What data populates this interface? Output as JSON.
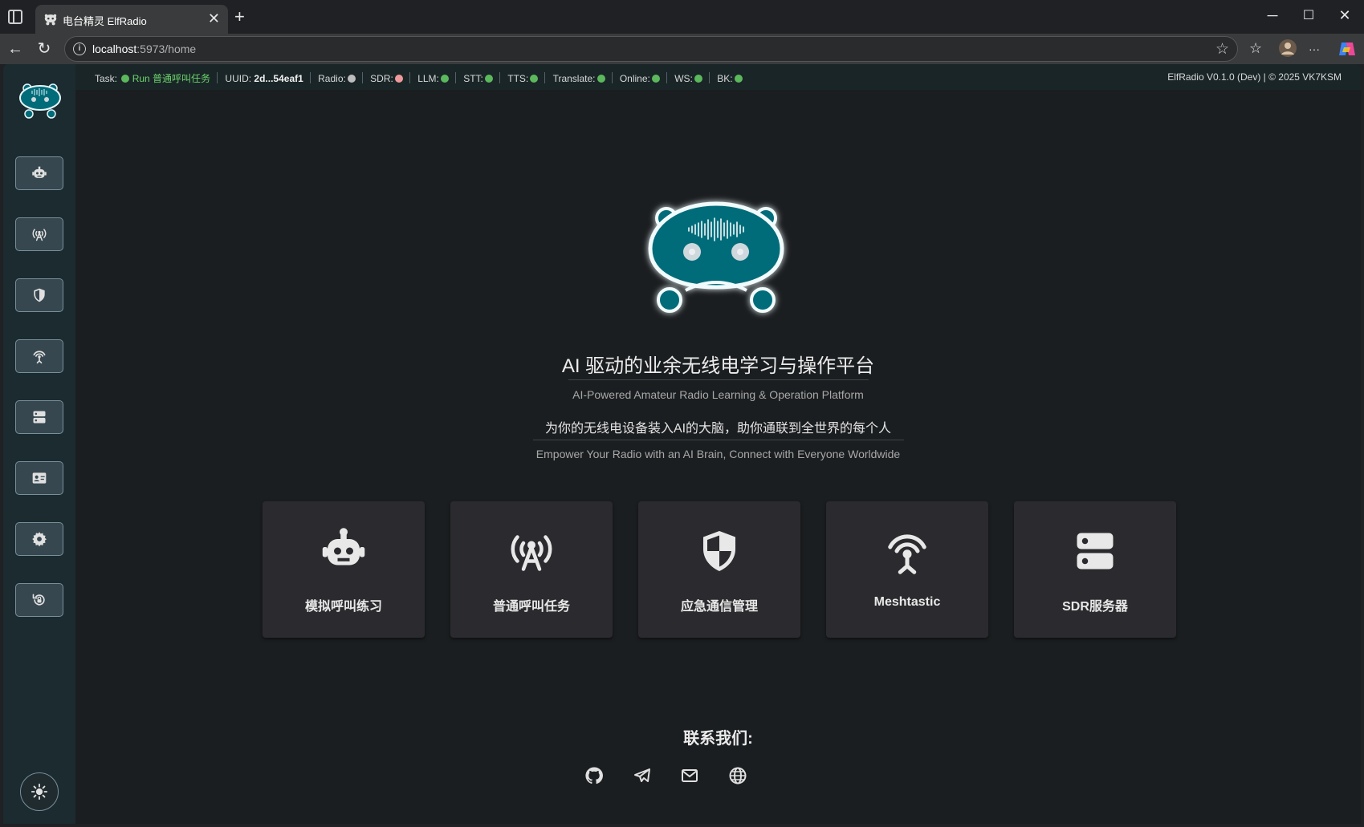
{
  "browser": {
    "tab_title": "电台精灵 ElfRadio",
    "url_host": "localhost",
    "url_rest": ":5973/home",
    "tab_close": "✕",
    "new_tab": "+",
    "minimize": "─",
    "maximize": "☐",
    "close": "✕",
    "back": "←",
    "reload": "↻",
    "info": "i",
    "favorite": "☆",
    "favorites_bar": "☆",
    "more": "···"
  },
  "statusbar": {
    "items": [
      {
        "label": "Task:",
        "value": "Run 普通呼叫任务",
        "color": "#5cb85c"
      },
      {
        "label": "UUID:",
        "value": "2d...54eaf1"
      },
      {
        "label": "Radio:",
        "color": "#bdbdbd"
      },
      {
        "label": "SDR:",
        "color": "#ef9a9a"
      },
      {
        "label": "LLM:",
        "color": "#5cb85c"
      },
      {
        "label": "STT:",
        "color": "#5cb85c"
      },
      {
        "label": "TTS:",
        "color": "#5cb85c"
      },
      {
        "label": "Translate:",
        "color": "#5cb85c"
      },
      {
        "label": "Online:",
        "color": "#5cb85c"
      },
      {
        "label": "WS:",
        "color": "#5cb85c"
      },
      {
        "label": "BK:",
        "color": "#5cb85c"
      }
    ],
    "version": "ElfRadio V0.1.0 (Dev) | © 2025 VK7KSM"
  },
  "sidebar": {
    "items": [
      {
        "icon": "robot-icon"
      },
      {
        "icon": "antenna-icon"
      },
      {
        "icon": "shield-icon"
      },
      {
        "icon": "broadcast-tower-icon"
      },
      {
        "icon": "server-icon"
      },
      {
        "icon": "contact-card-icon"
      },
      {
        "icon": "gear-icon"
      },
      {
        "icon": "restore-icon"
      }
    ],
    "theme_icon": "sun-icon"
  },
  "hero": {
    "title": "AI 驱动的业余无线电学习与操作平台",
    "subtitle": "AI-Powered Amateur Radio Learning & Operation Platform",
    "tagline_cn": "为你的无线电设备装入AI的大脑，助你通联到全世界的每个人",
    "tagline_en": "Empower Your Radio with an AI Brain, Connect with Everyone Worldwide"
  },
  "cards": [
    {
      "label": "模拟呼叫练习",
      "icon": "robot-icon"
    },
    {
      "label": "普通呼叫任务",
      "icon": "antenna-icon"
    },
    {
      "label": "应急通信管理",
      "icon": "shield-icon"
    },
    {
      "label": "Meshtastic",
      "icon": "broadcast-tower-icon"
    },
    {
      "label": "SDR服务器",
      "icon": "server-icon"
    }
  ],
  "contact": {
    "title": "联系我们:",
    "links": [
      "github-icon",
      "telegram-icon",
      "email-icon",
      "globe-icon"
    ]
  },
  "colors": {
    "accent_teal": "#006c7a",
    "status_green": "#5cb85c",
    "status_red": "#ef9a9a"
  }
}
